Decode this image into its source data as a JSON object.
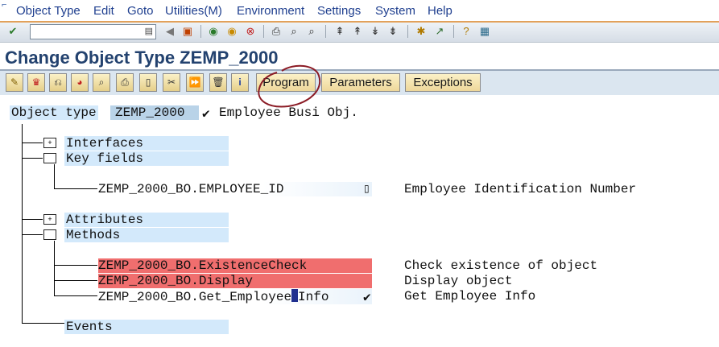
{
  "menu": {
    "items": [
      "Object Type",
      "Edit",
      "Goto",
      "Utilities(M)",
      "Environment",
      "Settings",
      "System",
      "Help"
    ]
  },
  "system_toolbar": {
    "command_field_value": "",
    "icons": [
      "enter-icon",
      "command-dropdown-icon",
      "back-arrow-icon",
      "save-icon",
      "back-icon",
      "exit-icon",
      "cancel-icon",
      "print-icon",
      "find-icon",
      "find-next-icon",
      "first-page-icon",
      "previous-page-icon",
      "next-page-icon",
      "last-page-icon",
      "create-session-icon",
      "shortcut-icon",
      "help-icon",
      "customize-layout-icon"
    ]
  },
  "title": "Change Object Type ZEMP_2000",
  "app_toolbar": {
    "buttons": [
      "Program",
      "Parameters",
      "Exceptions"
    ],
    "icons": [
      "change-icon",
      "generate-icon",
      "release-icon",
      "dispatch-icon",
      "test-icon",
      "print-icon",
      "create-icon",
      "cut-icon",
      "redefine-icon",
      "delete-icon",
      "info-icon"
    ]
  },
  "object": {
    "label": "Object type",
    "value": "ZEMP_2000",
    "status_mark": "✔",
    "description": "Employee Busi Obj."
  },
  "tree": {
    "interfaces": "Interfaces",
    "key_fields": "Key fields",
    "key_field_items": [
      {
        "name": "ZEMP_2000_BO.EMPLOYEE_ID",
        "description": "Employee Identification Number"
      }
    ],
    "attributes": "Attributes",
    "methods": "Methods",
    "method_items": [
      {
        "name": "ZEMP_2000_BO.ExistenceCheck",
        "description": "Check existence of object"
      },
      {
        "name": "ZEMP_2000_BO.Display",
        "description": "Display object"
      },
      {
        "name_before_cursor": "ZEMP_2000_BO.Get_Employee",
        "name_after_cursor": "Info",
        "status_mark": "✔",
        "description": "Get Employee Info"
      }
    ],
    "events": "Events"
  },
  "colors": {
    "menu_text": "#1f3f8f",
    "title": "#23426f",
    "error_row": "#f06e6e",
    "field_highlight": "#d3e9fb",
    "annotation_circle": "#8b1b25"
  }
}
